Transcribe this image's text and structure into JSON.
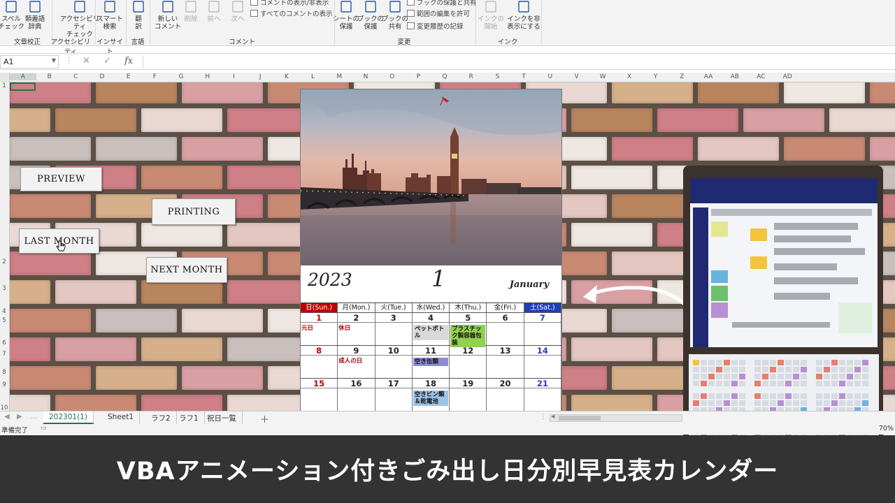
{
  "ribbon": {
    "buttons": [
      {
        "label": "スペル\nチェック",
        "icon": "spellcheck-icon"
      },
      {
        "label": "類義語\n辞典",
        "icon": "thesaurus-icon"
      },
      {
        "label": "アクセシビリティ\nチェック",
        "icon": "accessibility-icon"
      },
      {
        "label": "スマート\n検索",
        "icon": "smart-lookup-icon"
      },
      {
        "label": "翻\n訳",
        "icon": "translate-icon"
      },
      {
        "label": "新しい\nコメント",
        "icon": "new-comment-icon"
      },
      {
        "label": "削除",
        "icon": "delete-comment-icon"
      },
      {
        "label": "前へ",
        "icon": "previous-comment-icon"
      },
      {
        "label": "次へ",
        "icon": "next-comment-icon"
      },
      {
        "label": "シートの\n保護",
        "icon": "protect-sheet-icon"
      },
      {
        "label": "ブックの\n保護",
        "icon": "protect-book-icon"
      },
      {
        "label": "ブックの\n共有",
        "icon": "share-book-icon"
      },
      {
        "label": "インクの\n開始",
        "icon": "ink-start-icon"
      },
      {
        "label": "インクを非\n表示にする",
        "icon": "ink-hide-icon"
      }
    ],
    "small": {
      "show_all_comments": "すべてのコメントの表示",
      "show_hide_comment": "コメントの表示/非表示",
      "protect_share": "ブックの保護と共有",
      "allow_edit_ranges": "範囲の編集を許可",
      "track_changes": "変更履歴の記録"
    },
    "groups": {
      "proofing": "文章校正",
      "accessibility": "アクセシビリティ",
      "insights": "インサイト",
      "language": "言語",
      "comments": "コメント",
      "changes": "変更",
      "ink": "インク"
    }
  },
  "formula_bar": {
    "name_box": "A1",
    "cancel": "✕",
    "enter": "✓",
    "fx": "fx",
    "formula": ""
  },
  "columns": [
    "A",
    "B",
    "C",
    "D",
    "E",
    "F",
    "G",
    "H",
    "I",
    "J",
    "K",
    "L",
    "M",
    "N",
    "O",
    "P",
    "Q",
    "R",
    "S",
    "T",
    "U",
    "V",
    "W",
    "X",
    "Y",
    "Z",
    "AA",
    "AB",
    "AC",
    "AD"
  ],
  "rows": [
    "1",
    "2",
    "3",
    "4",
    "5",
    "6",
    "7",
    "8",
    "9",
    "10"
  ],
  "macro_buttons": {
    "preview": "PREVIEW",
    "printing": "PRINTING",
    "last_month": "LAST MONTH",
    "next_month": "NEXT MONTH"
  },
  "calendar": {
    "year": "2023",
    "month": "1",
    "month_name": "January",
    "weekdays": [
      {
        "label": "日(Sun.)",
        "kind": "sun"
      },
      {
        "label": "月(Mon.)",
        "kind": ""
      },
      {
        "label": "火(Tue.)",
        "kind": ""
      },
      {
        "label": "水(Wed.)",
        "kind": ""
      },
      {
        "label": "木(Thu.)",
        "kind": ""
      },
      {
        "label": "金(Fri.)",
        "kind": ""
      },
      {
        "label": "土(Sat.)",
        "kind": "sat"
      }
    ],
    "weeks": [
      [
        {
          "day": "1",
          "kind": "sun",
          "event": "元日",
          "event_style": "red"
        },
        {
          "day": "2",
          "kind": "",
          "event": "休日",
          "event_style": "red"
        },
        {
          "day": "3",
          "kind": "",
          "event": "",
          "event_style": ""
        },
        {
          "day": "4",
          "kind": "",
          "event": "ペットボトル",
          "event_style": "gray"
        },
        {
          "day": "5",
          "kind": "",
          "event": "プラスチック製容器包装",
          "event_style": "green"
        },
        {
          "day": "6",
          "kind": "",
          "event": "",
          "event_style": ""
        },
        {
          "day": "7",
          "kind": "sat",
          "event": "",
          "event_style": ""
        }
      ],
      [
        {
          "day": "8",
          "kind": "sun",
          "event": "",
          "event_style": ""
        },
        {
          "day": "9",
          "kind": "",
          "event": "成人の日",
          "event_style": "red"
        },
        {
          "day": "10",
          "kind": "",
          "event": "",
          "event_style": ""
        },
        {
          "day": "11",
          "kind": "",
          "event": "空き缶類",
          "event_style": "purple"
        },
        {
          "day": "12",
          "kind": "",
          "event": "",
          "event_style": ""
        },
        {
          "day": "13",
          "kind": "",
          "event": "",
          "event_style": ""
        },
        {
          "day": "14",
          "kind": "sat",
          "event": "",
          "event_style": ""
        }
      ],
      [
        {
          "day": "15",
          "kind": "sun",
          "event": "",
          "event_style": ""
        },
        {
          "day": "16",
          "kind": "",
          "event": "",
          "event_style": ""
        },
        {
          "day": "17",
          "kind": "",
          "event": "",
          "event_style": ""
        },
        {
          "day": "18",
          "kind": "",
          "event": "空きビン類＆乾電池",
          "event_style": "blue"
        },
        {
          "day": "19",
          "kind": "",
          "event": "",
          "event_style": ""
        },
        {
          "day": "20",
          "kind": "",
          "event": "",
          "event_style": ""
        },
        {
          "day": "21",
          "kind": "sat",
          "event": "",
          "event_style": ""
        }
      ]
    ]
  },
  "sheet_tabs": [
    "202301(1)",
    "Sheet1",
    "ラフ2",
    "ラフ1",
    "祝日一覧"
  ],
  "add_sheet": "＋",
  "status": {
    "ready": "準備完了",
    "zoom": "70%"
  },
  "caption": "VBAアニメーション付きごみ出し日分別早見表カレンダー",
  "colors": {
    "excel_green": "#217346",
    "sunday_red": "#c00000",
    "saturday_blue": "#1f3fb7",
    "caption_bg": "#333333"
  }
}
